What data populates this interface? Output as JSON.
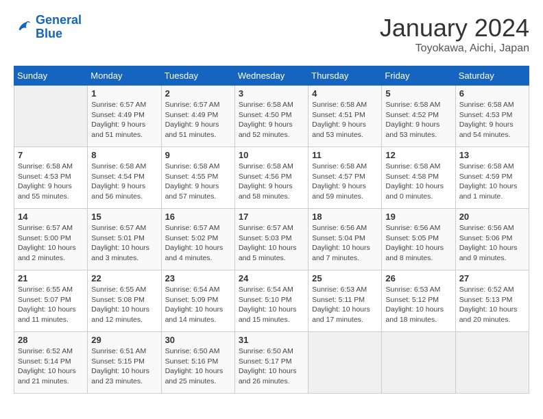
{
  "header": {
    "logo_line1": "General",
    "logo_line2": "Blue",
    "title": "January 2024",
    "subtitle": "Toyokawa, Aichi, Japan"
  },
  "weekdays": [
    "Sunday",
    "Monday",
    "Tuesday",
    "Wednesday",
    "Thursday",
    "Friday",
    "Saturday"
  ],
  "weeks": [
    [
      {
        "num": "",
        "empty": true
      },
      {
        "num": "1",
        "sunrise": "6:57 AM",
        "sunset": "4:49 PM",
        "daylight": "9 hours and 51 minutes."
      },
      {
        "num": "2",
        "sunrise": "6:57 AM",
        "sunset": "4:49 PM",
        "daylight": "9 hours and 51 minutes."
      },
      {
        "num": "3",
        "sunrise": "6:58 AM",
        "sunset": "4:50 PM",
        "daylight": "9 hours and 52 minutes."
      },
      {
        "num": "4",
        "sunrise": "6:58 AM",
        "sunset": "4:51 PM",
        "daylight": "9 hours and 53 minutes."
      },
      {
        "num": "5",
        "sunrise": "6:58 AM",
        "sunset": "4:52 PM",
        "daylight": "9 hours and 53 minutes."
      },
      {
        "num": "6",
        "sunrise": "6:58 AM",
        "sunset": "4:53 PM",
        "daylight": "9 hours and 54 minutes."
      }
    ],
    [
      {
        "num": "7",
        "sunrise": "6:58 AM",
        "sunset": "4:53 PM",
        "daylight": "9 hours and 55 minutes."
      },
      {
        "num": "8",
        "sunrise": "6:58 AM",
        "sunset": "4:54 PM",
        "daylight": "9 hours and 56 minutes."
      },
      {
        "num": "9",
        "sunrise": "6:58 AM",
        "sunset": "4:55 PM",
        "daylight": "9 hours and 57 minutes."
      },
      {
        "num": "10",
        "sunrise": "6:58 AM",
        "sunset": "4:56 PM",
        "daylight": "9 hours and 58 minutes."
      },
      {
        "num": "11",
        "sunrise": "6:58 AM",
        "sunset": "4:57 PM",
        "daylight": "9 hours and 59 minutes."
      },
      {
        "num": "12",
        "sunrise": "6:58 AM",
        "sunset": "4:58 PM",
        "daylight": "10 hours and 0 minutes."
      },
      {
        "num": "13",
        "sunrise": "6:58 AM",
        "sunset": "4:59 PM",
        "daylight": "10 hours and 1 minute."
      }
    ],
    [
      {
        "num": "14",
        "sunrise": "6:57 AM",
        "sunset": "5:00 PM",
        "daylight": "10 hours and 2 minutes."
      },
      {
        "num": "15",
        "sunrise": "6:57 AM",
        "sunset": "5:01 PM",
        "daylight": "10 hours and 3 minutes."
      },
      {
        "num": "16",
        "sunrise": "6:57 AM",
        "sunset": "5:02 PM",
        "daylight": "10 hours and 4 minutes."
      },
      {
        "num": "17",
        "sunrise": "6:57 AM",
        "sunset": "5:03 PM",
        "daylight": "10 hours and 5 minutes."
      },
      {
        "num": "18",
        "sunrise": "6:56 AM",
        "sunset": "5:04 PM",
        "daylight": "10 hours and 7 minutes."
      },
      {
        "num": "19",
        "sunrise": "6:56 AM",
        "sunset": "5:05 PM",
        "daylight": "10 hours and 8 minutes."
      },
      {
        "num": "20",
        "sunrise": "6:56 AM",
        "sunset": "5:06 PM",
        "daylight": "10 hours and 9 minutes."
      }
    ],
    [
      {
        "num": "21",
        "sunrise": "6:55 AM",
        "sunset": "5:07 PM",
        "daylight": "10 hours and 11 minutes."
      },
      {
        "num": "22",
        "sunrise": "6:55 AM",
        "sunset": "5:08 PM",
        "daylight": "10 hours and 12 minutes."
      },
      {
        "num": "23",
        "sunrise": "6:54 AM",
        "sunset": "5:09 PM",
        "daylight": "10 hours and 14 minutes."
      },
      {
        "num": "24",
        "sunrise": "6:54 AM",
        "sunset": "5:10 PM",
        "daylight": "10 hours and 15 minutes."
      },
      {
        "num": "25",
        "sunrise": "6:53 AM",
        "sunset": "5:11 PM",
        "daylight": "10 hours and 17 minutes."
      },
      {
        "num": "26",
        "sunrise": "6:53 AM",
        "sunset": "5:12 PM",
        "daylight": "10 hours and 18 minutes."
      },
      {
        "num": "27",
        "sunrise": "6:52 AM",
        "sunset": "5:13 PM",
        "daylight": "10 hours and 20 minutes."
      }
    ],
    [
      {
        "num": "28",
        "sunrise": "6:52 AM",
        "sunset": "5:14 PM",
        "daylight": "10 hours and 21 minutes."
      },
      {
        "num": "29",
        "sunrise": "6:51 AM",
        "sunset": "5:15 PM",
        "daylight": "10 hours and 23 minutes."
      },
      {
        "num": "30",
        "sunrise": "6:50 AM",
        "sunset": "5:16 PM",
        "daylight": "10 hours and 25 minutes."
      },
      {
        "num": "31",
        "sunrise": "6:50 AM",
        "sunset": "5:17 PM",
        "daylight": "10 hours and 26 minutes."
      },
      {
        "num": "",
        "empty": true
      },
      {
        "num": "",
        "empty": true
      },
      {
        "num": "",
        "empty": true
      }
    ]
  ]
}
